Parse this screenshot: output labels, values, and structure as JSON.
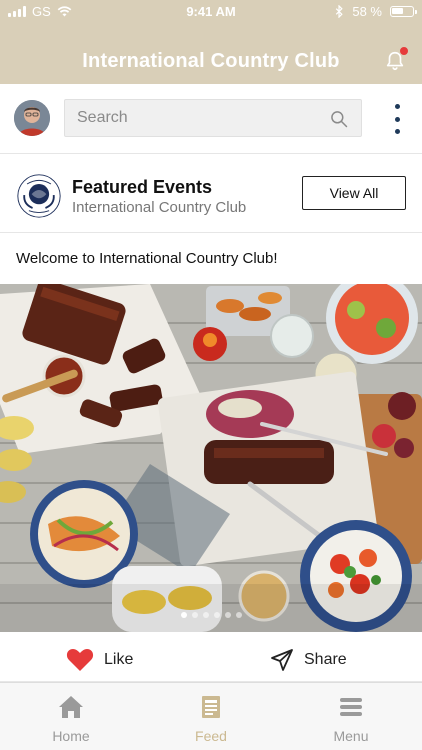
{
  "status": {
    "carrier": "GS",
    "time": "9:41 AM",
    "battery": "58 %"
  },
  "header": {
    "title": "International Country Club"
  },
  "search": {
    "placeholder": "Search"
  },
  "featured": {
    "title": "Featured Events",
    "subtitle": "International Country Club",
    "button_label": "View All",
    "logo_text": "INTERNATIONAL COUNTRY CLUB"
  },
  "post": {
    "text": "Welcome to International Country Club!",
    "carousel_total": 6,
    "carousel_active": 1
  },
  "actions": {
    "like_label": "Like",
    "share_label": "Share"
  },
  "tabs": [
    {
      "label": "Home",
      "icon": "home-icon"
    },
    {
      "label": "Feed",
      "icon": "feed-icon",
      "active": true
    },
    {
      "label": "Menu",
      "icon": "menu-icon"
    }
  ],
  "colors": {
    "header_bg": "#d9cfb8",
    "accent_red": "#e63b3b",
    "active_tab": "#cbb991",
    "kebab": "#1f3a5a"
  }
}
